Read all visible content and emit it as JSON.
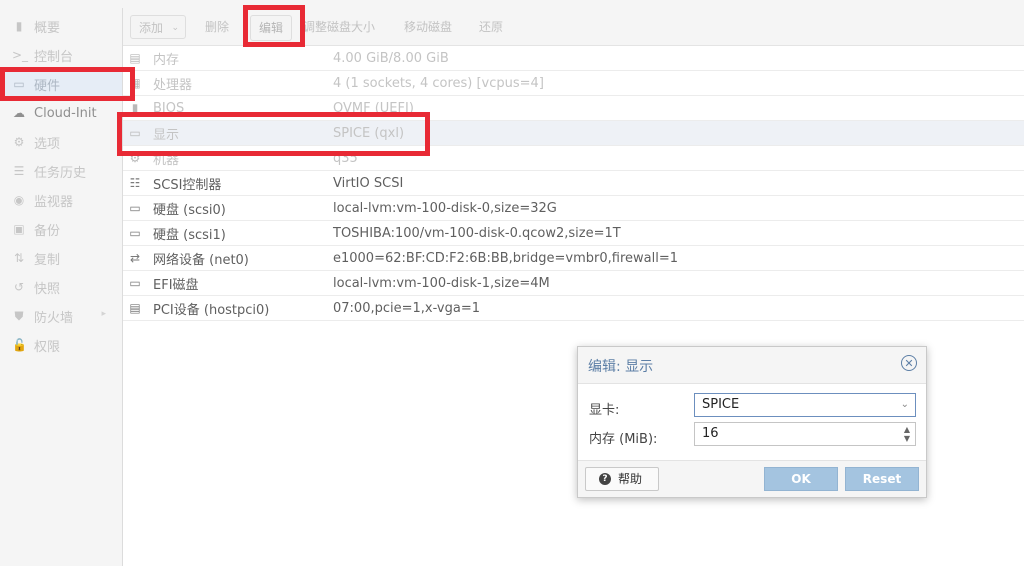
{
  "sidebar": {
    "items": [
      {
        "label": "概要",
        "icon": "book-icon"
      },
      {
        "label": "控制台",
        "icon": "terminal-icon"
      },
      {
        "label": "硬件",
        "icon": "monitor-icon"
      },
      {
        "label": "Cloud-Init",
        "icon": "cloud-icon"
      },
      {
        "label": "选项",
        "icon": "gear-icon"
      },
      {
        "label": "任务历史",
        "icon": "list-icon"
      },
      {
        "label": "监视器",
        "icon": "eye-icon"
      },
      {
        "label": "备份",
        "icon": "floppy-icon"
      },
      {
        "label": "复制",
        "icon": "retweet-icon"
      },
      {
        "label": "快照",
        "icon": "history-icon"
      },
      {
        "label": "防火墙",
        "icon": "shield-icon"
      },
      {
        "label": "权限",
        "icon": "unlock-icon"
      }
    ]
  },
  "toolbar": {
    "add_label": "添加",
    "delete_label": "删除",
    "edit_label": "编辑",
    "resize_label": "调整磁盘大小",
    "move_label": "移动磁盘",
    "revert_label": "还原"
  },
  "hardware": {
    "rows": [
      {
        "key": "内存",
        "value": "4.00 GiB/8.00 GiB",
        "icon": "memory-icon"
      },
      {
        "key": "处理器",
        "value": "4 (1 sockets, 4 cores) [vcpus=4]",
        "icon": "cpu-icon"
      },
      {
        "key": "BIOS",
        "value": "OVMF (UEFI)",
        "icon": "microchip-icon"
      },
      {
        "key": "显示",
        "value": "SPICE (qxl)",
        "icon": "desktop-icon"
      },
      {
        "key": "机器",
        "value": "q35",
        "icon": "cogs-icon"
      },
      {
        "key": "SCSI控制器",
        "value": "VirtIO SCSI",
        "icon": "database-icon"
      },
      {
        "key": "硬盘 (scsi0)",
        "value": "local-lvm:vm-100-disk-0,size=32G",
        "icon": "hdd-icon"
      },
      {
        "key": "硬盘 (scsi1)",
        "value": "TOSHIBA:100/vm-100-disk-0.qcow2,size=1T",
        "icon": "hdd-icon"
      },
      {
        "key": "网络设备 (net0)",
        "value": "e1000=62:BF:CD:F2:6B:BB,bridge=vmbr0,firewall=1",
        "icon": "exchange-icon"
      },
      {
        "key": "EFI磁盘",
        "value": "local-lvm:vm-100-disk-1,size=4M",
        "icon": "hdd-icon"
      },
      {
        "key": "PCI设备 (hostpci0)",
        "value": "07:00,pcie=1,x-vga=1",
        "icon": "pci-card-icon"
      }
    ]
  },
  "dialog": {
    "title": "编辑: 显示",
    "graphic_label": "显卡:",
    "graphic_value": "SPICE",
    "memory_label": "内存 (MiB):",
    "memory_value": "16",
    "help_label": "帮助",
    "ok_label": "OK",
    "reset_label": "Reset"
  },
  "colors": {
    "highlight": "#e82a35",
    "accent": "#5d7fa6",
    "button_disabled": "#a4c4e0"
  }
}
